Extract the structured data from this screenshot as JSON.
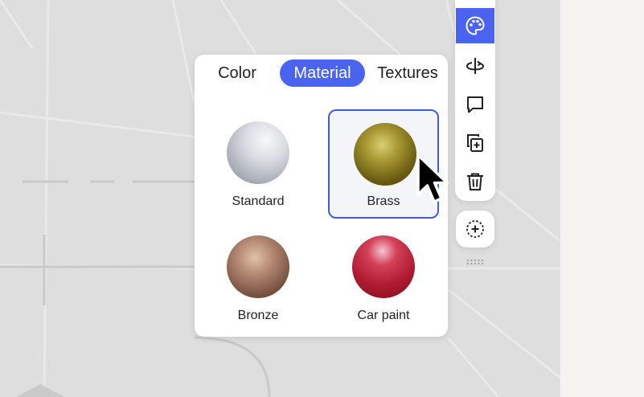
{
  "material_popover": {
    "tabs": [
      {
        "label": "Color",
        "active": false
      },
      {
        "label": "Material",
        "active": true
      },
      {
        "label": "Textures",
        "active": false
      }
    ],
    "materials": [
      {
        "label": "Standard",
        "selected": false
      },
      {
        "label": "Brass",
        "selected": true
      },
      {
        "label": "Bronze",
        "selected": false
      },
      {
        "label": "Car paint",
        "selected": false
      }
    ]
  },
  "toolbar": {
    "tools": [
      {
        "icon": "palette-icon",
        "active": true
      },
      {
        "icon": "rotate-icon",
        "active": false
      },
      {
        "icon": "comment-icon",
        "active": false
      },
      {
        "icon": "duplicate-icon",
        "active": false
      },
      {
        "icon": "trash-icon",
        "active": false
      }
    ],
    "add_icon": "add-circle-icon",
    "grip_icon": "drag-handle-icon"
  },
  "colors": {
    "accent": "#4a63f0",
    "viewport_background": "#dedede",
    "app_background": "#f5f2ef"
  }
}
